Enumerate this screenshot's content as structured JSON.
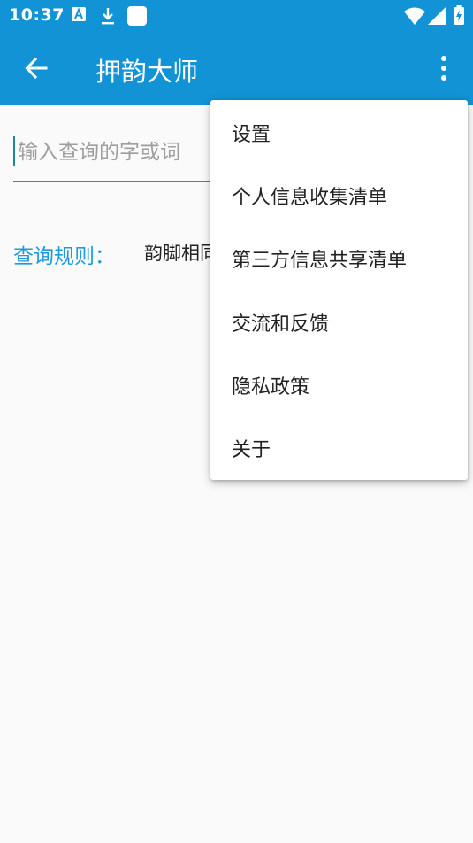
{
  "status_bar": {
    "time": "10:37",
    "icons": [
      "a-notification-icon",
      "download-icon",
      "app-square-icon",
      "wifi-icon",
      "signal-icon",
      "battery-charging-icon"
    ]
  },
  "app_bar": {
    "title": "押韵大师",
    "back_icon": "arrow-left-icon",
    "menu_icon": "more-vertical-icon"
  },
  "search": {
    "placeholder": "输入查询的字或词",
    "value": ""
  },
  "query_rule": {
    "label": "查询规则：",
    "value": "韵脚相同"
  },
  "overflow_menu": {
    "items": [
      {
        "label": "设置"
      },
      {
        "label": "个人信息收集清单"
      },
      {
        "label": "第三方信息共享清单"
      },
      {
        "label": "交流和反馈"
      },
      {
        "label": "隐私政策"
      },
      {
        "label": "关于"
      }
    ]
  },
  "colors": {
    "primary": "#1193d5",
    "accent_text": "#1e9be0",
    "background": "#fafafa"
  }
}
